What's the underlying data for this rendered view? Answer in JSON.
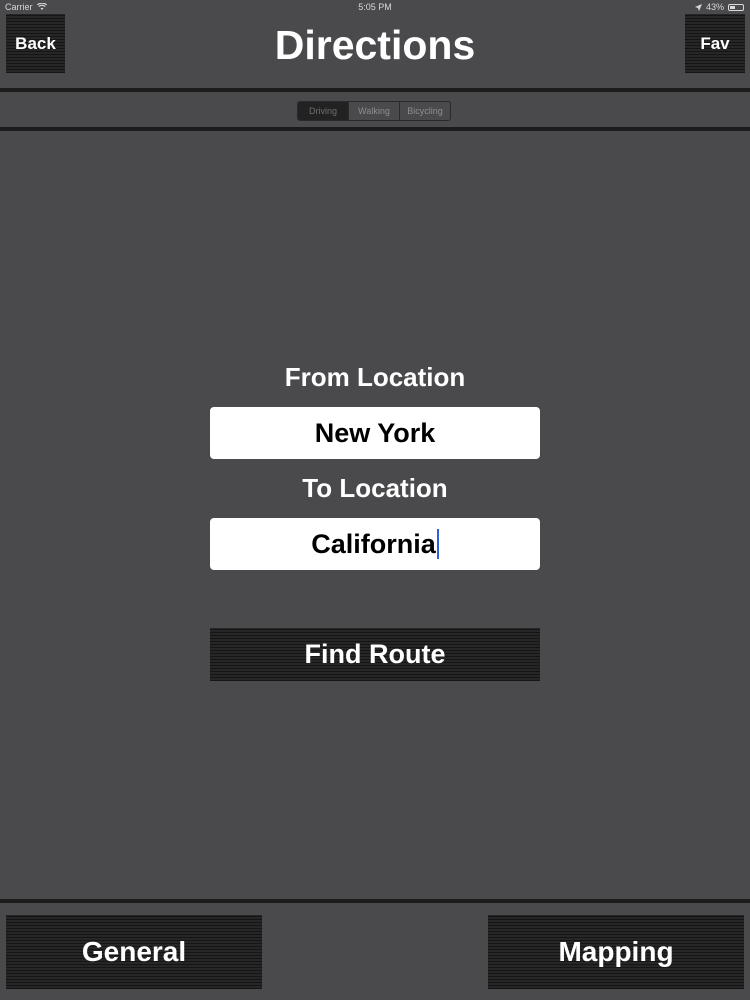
{
  "status_bar": {
    "carrier": "Carrier",
    "time": "5:05 PM",
    "battery": "43%",
    "battery_level": 0.43
  },
  "header": {
    "back_label": "Back",
    "title": "Directions",
    "fav_label": "Fav"
  },
  "transport_modes": {
    "options": [
      "Driving",
      "Walking",
      "Bicycling"
    ],
    "selected": "Driving"
  },
  "form": {
    "from_label": "From Location",
    "from_value": "New York",
    "to_label": "To Location",
    "to_value": "California",
    "submit_label": "Find Route"
  },
  "bottom_bar": {
    "general_label": "General",
    "mapping_label": "Mapping"
  }
}
